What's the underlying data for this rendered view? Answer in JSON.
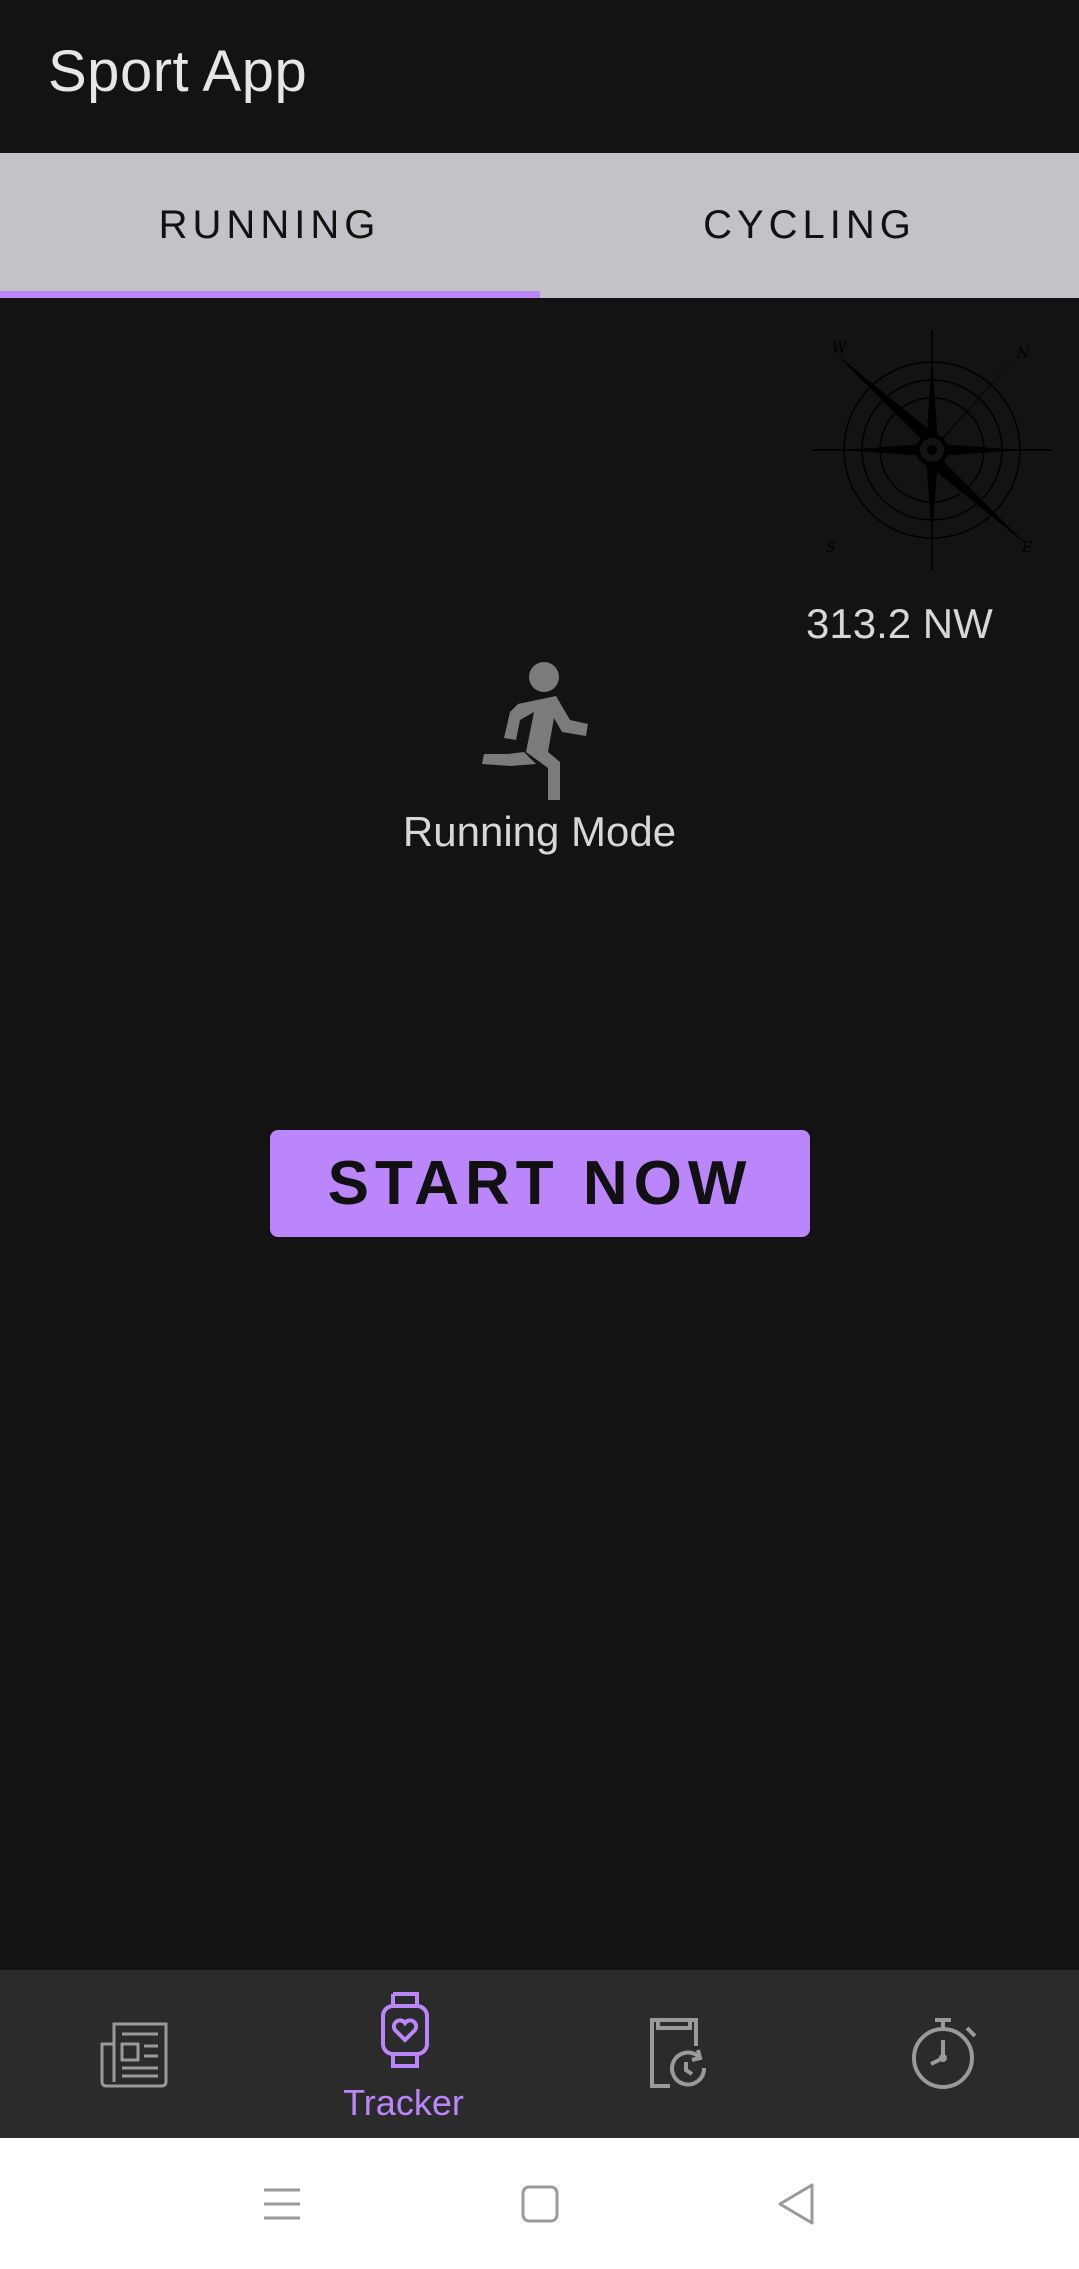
{
  "app_bar": {
    "title": "Sport App"
  },
  "tabs": [
    {
      "label": "RUNNING",
      "selected": true
    },
    {
      "label": "CYCLING",
      "selected": false
    }
  ],
  "compass": {
    "heading_text": "313.2 NW",
    "icon": "compass-icon"
  },
  "mode": {
    "label": "Running Mode",
    "icon": "running-person-icon"
  },
  "start_button": {
    "label": "START NOW"
  },
  "bottom_nav": {
    "items": [
      {
        "icon": "newspaper-icon",
        "label": "",
        "active": false
      },
      {
        "icon": "smartwatch-heart-icon",
        "label": "Tracker",
        "active": true
      },
      {
        "icon": "history-clipboard-icon",
        "label": "",
        "active": false
      },
      {
        "icon": "stopwatch-icon",
        "label": "",
        "active": false
      }
    ]
  },
  "system_nav": {
    "icons": [
      "menu-icon",
      "home-square-icon",
      "back-triangle-icon"
    ]
  },
  "colors": {
    "accent": "#bb86fc",
    "background": "#131313",
    "tab_bar": "#c3c2c7",
    "bottom_nav": "#2b2b2b"
  }
}
